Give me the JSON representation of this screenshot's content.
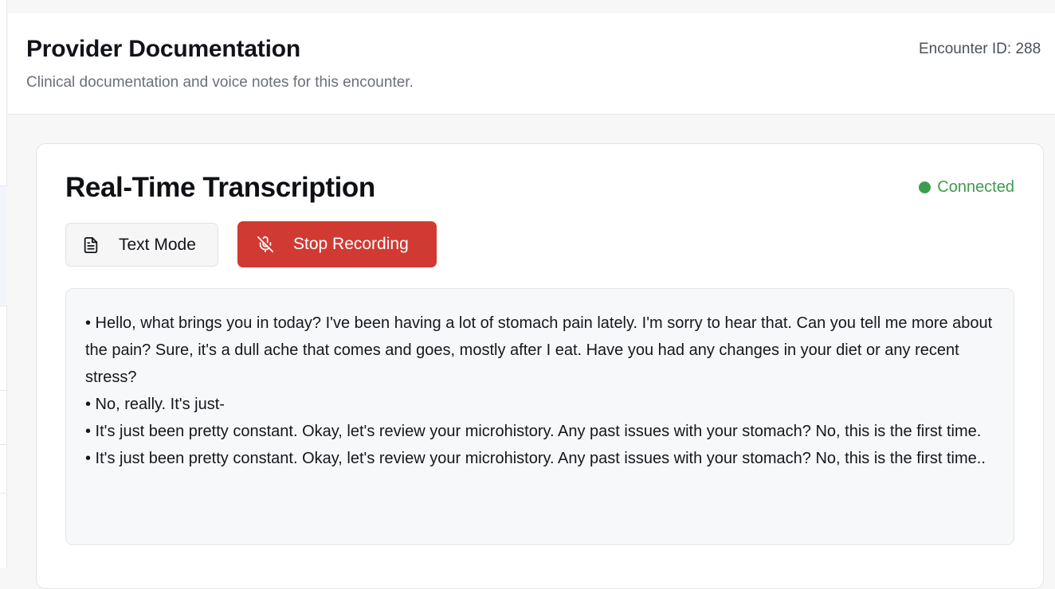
{
  "header": {
    "title": "Provider Documentation",
    "subtitle": "Clinical documentation and voice notes for this encounter.",
    "encounter_label": "Encounter ID: 288"
  },
  "card": {
    "title": "Real-Time Transcription",
    "status": {
      "label": "Connected",
      "color": "#3f9c4f"
    },
    "buttons": {
      "text_mode": {
        "label": "Text Mode",
        "icon": "document-icon"
      },
      "stop_recording": {
        "label": "Stop Recording",
        "icon": "mic-off-icon",
        "color": "#d03a33"
      }
    },
    "transcript": [
      "• Hello, what brings you in today? I've been having a lot of stomach pain lately. I'm sorry to hear that. Can you tell me more about the pain? Sure, it's a dull ache that comes and goes, mostly after I eat. Have you had any changes in your diet or any recent stress?",
      "• No, really. It's just-",
      "• It's just been pretty constant. Okay, let's review your microhistory. Any past issues with your stomach? No, this is the first time.",
      "• It's just been pretty constant. Okay, let's review your microhistory. Any past issues with your stomach? No, this is the first time.."
    ]
  }
}
